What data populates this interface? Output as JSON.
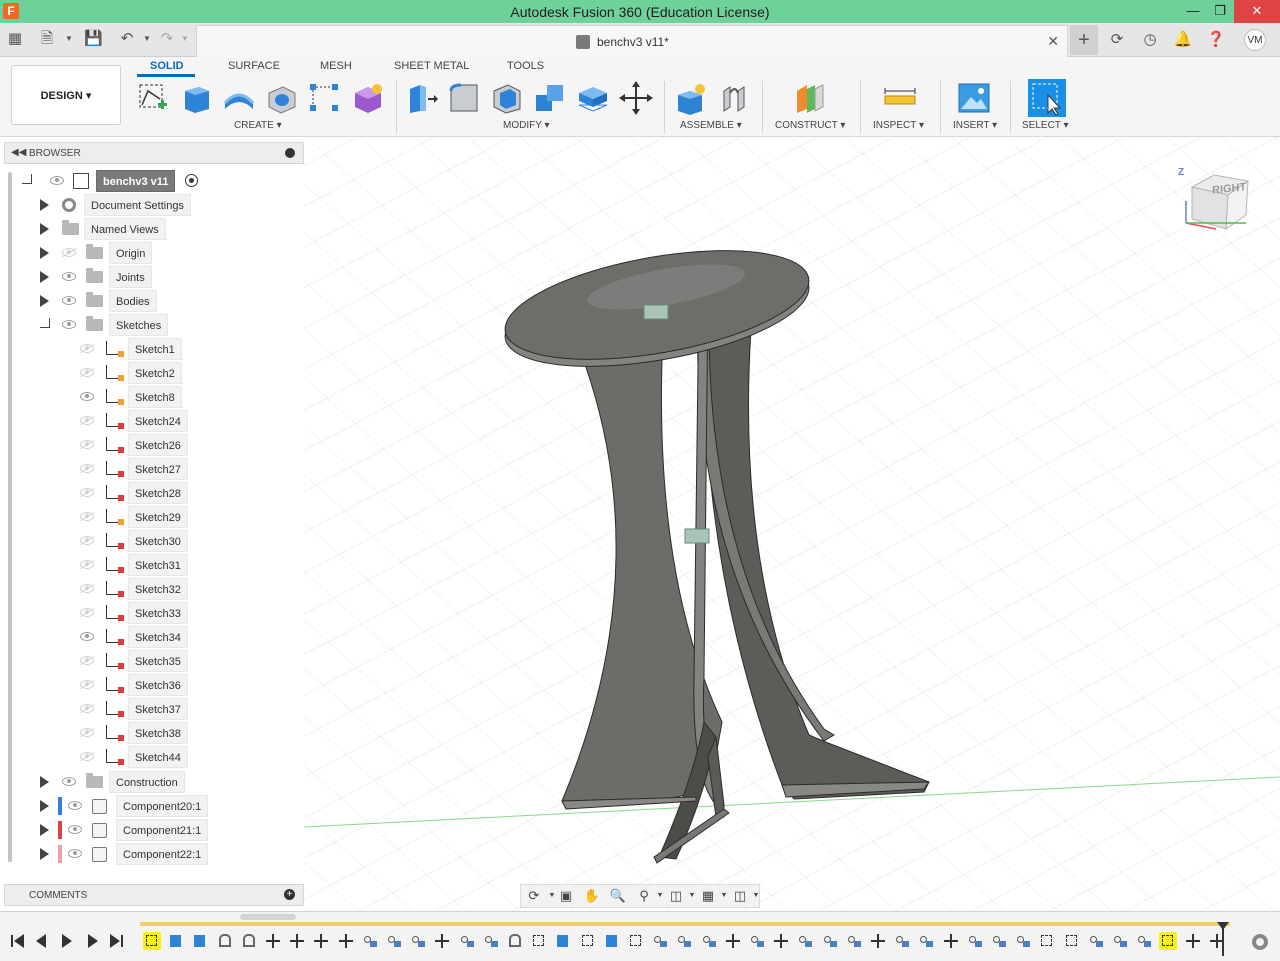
{
  "window": {
    "title": "Autodesk Fusion 360 (Education License)",
    "logo_letter": "F"
  },
  "tabbar": {
    "document_tab": "benchv3 v11*",
    "avatar_initials": "VM"
  },
  "ribbon": {
    "workspace": "DESIGN",
    "tabs": [
      "SOLID",
      "SURFACE",
      "MESH",
      "SHEET METAL",
      "TOOLS"
    ],
    "active_tab": "SOLID",
    "groups": {
      "create": "CREATE",
      "modify": "MODIFY",
      "assemble": "ASSEMBLE",
      "construct": "CONSTRUCT",
      "inspect": "INSPECT",
      "insert": "INSERT",
      "select": "SELECT"
    }
  },
  "browser": {
    "title": "BROWSER",
    "root": "benchv3 v11",
    "items": [
      {
        "label": "Document Settings",
        "icon": "gear-icon"
      },
      {
        "label": "Named Views",
        "icon": "folder-icon"
      },
      {
        "label": "Origin",
        "icon": "folder-icon",
        "visible": false
      },
      {
        "label": "Joints",
        "icon": "folder-icon",
        "visible": true
      },
      {
        "label": "Bodies",
        "icon": "folder-icon",
        "visible": true
      },
      {
        "label": "Sketches",
        "icon": "folder-icon",
        "visible": true,
        "expanded": true
      }
    ],
    "sketches": [
      {
        "label": "Sketch1",
        "visible": false,
        "warn": true
      },
      {
        "label": "Sketch2",
        "visible": false,
        "warn": true
      },
      {
        "label": "Sketch8",
        "visible": true,
        "warn": true
      },
      {
        "label": "Sketch24",
        "visible": false,
        "warn": false
      },
      {
        "label": "Sketch26",
        "visible": false,
        "warn": false
      },
      {
        "label": "Sketch27",
        "visible": false,
        "warn": false
      },
      {
        "label": "Sketch28",
        "visible": false,
        "warn": false
      },
      {
        "label": "Sketch29",
        "visible": false,
        "warn": true
      },
      {
        "label": "Sketch30",
        "visible": false,
        "warn": false
      },
      {
        "label": "Sketch31",
        "visible": false,
        "warn": false
      },
      {
        "label": "Sketch32",
        "visible": false,
        "warn": false
      },
      {
        "label": "Sketch33",
        "visible": false,
        "warn": false
      },
      {
        "label": "Sketch34",
        "visible": true,
        "warn": false
      },
      {
        "label": "Sketch35",
        "visible": false,
        "warn": false
      },
      {
        "label": "Sketch36",
        "visible": false,
        "warn": false
      },
      {
        "label": "Sketch37",
        "visible": false,
        "warn": false
      },
      {
        "label": "Sketch38",
        "visible": false,
        "warn": false
      },
      {
        "label": "Sketch44",
        "visible": false,
        "warn": false
      }
    ],
    "tail_items": [
      {
        "label": "Construction",
        "icon": "folder-icon",
        "visible": true
      }
    ],
    "components": [
      {
        "label": "Component20:1",
        "color": "#3b7ddd"
      },
      {
        "label": "Component21:1",
        "color": "#e04040"
      },
      {
        "label": "Component22:1",
        "color": "#f0a0a8"
      }
    ]
  },
  "viewcube": {
    "face_label": "RIGHT",
    "axis_z": "Z"
  },
  "comments": {
    "title": "COMMENTS"
  },
  "colors": {
    "titlebar": "#6fd19a",
    "accent": "#0c6bb8",
    "model_body": "#6e6c69",
    "timeline_track": "#f1d06a"
  }
}
